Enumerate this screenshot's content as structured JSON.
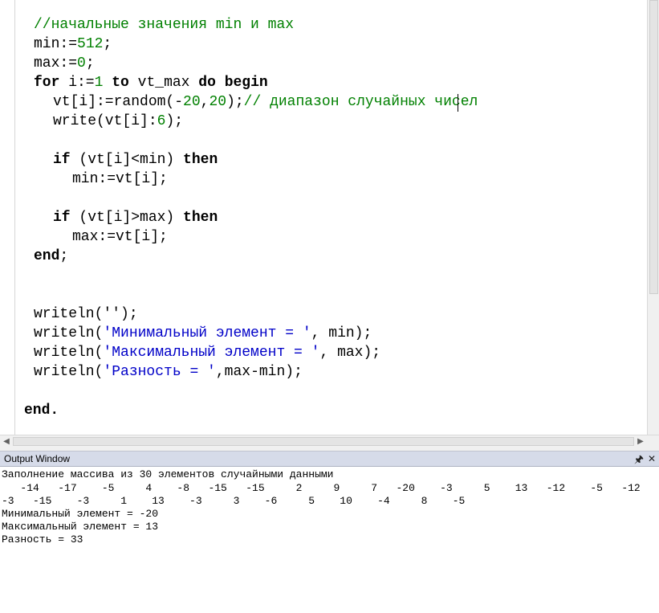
{
  "editor": {
    "comment_line": "//начальные значения min и max",
    "min_init": "min:=",
    "min_init_val": "512",
    "min_init_end": ";",
    "max_init": "max:=",
    "max_init_val": "0",
    "max_init_end": ";",
    "for_kw": "for",
    "for_var": " i:=",
    "for_val": "1",
    "to_kw": "to",
    "for_limit": " vt_max ",
    "do_kw": "do",
    "begin_kw": "begin",
    "random_a": "vt[i]:=random(-",
    "random_lo": "20",
    "random_comma": ",",
    "random_hi": "20",
    "random_end": ");",
    "random_comment": "// диапазон случайных чисел",
    "write_a": "write(vt[i]:",
    "write_n": "6",
    "write_end": ");",
    "if_kw": "if",
    "if1_cond": " (vt[i]<min) ",
    "then_kw": "then",
    "assign_min": "min:=vt[i];",
    "if2_cond": " (vt[i]>max) ",
    "assign_max": "max:=vt[i];",
    "end_kw": "end",
    "end_semi": ";",
    "writeln_empty": "writeln('');",
    "wl_prefix": "writeln(",
    "wl_min_str": "'Минимальный элемент = '",
    "wl_min_rest": ", min);",
    "wl_max_str": "'Максимальный элемент = '",
    "wl_max_rest": ", max);",
    "wl_diff_str": "'Разность = '",
    "wl_diff_rest": ",max-min);",
    "final_end": "end."
  },
  "output_window": {
    "title": "Output Window",
    "pin_icon": "pin-icon",
    "close_icon": "close-icon",
    "lines": [
      "Заполнение массива из 30 элементов случайными данными",
      "   -14   -17    -5     4    -8   -15   -15     2     9     7   -20    -3     5    13   -12    -5   -12",
      "-3   -15    -3     1    13    -3     3    -6     5    10    -4     8    -5",
      "Минимальный элемент = -20",
      "Максимальный элемент = 13",
      "Разность = 33"
    ]
  }
}
